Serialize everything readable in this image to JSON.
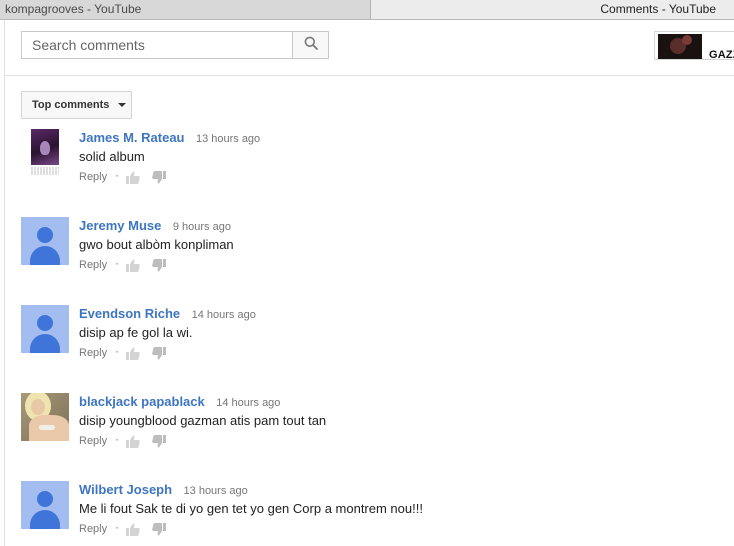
{
  "tabs": {
    "left": "kompagrooves - YouTube",
    "right": "Comments - YouTube"
  },
  "search": {
    "placeholder": "Search comments",
    "button_icon": "search-icon"
  },
  "related_video": {
    "title": "GAZZ"
  },
  "sort": {
    "label": "Top comments",
    "icon": "caret-down-icon"
  },
  "comments": [
    {
      "author": "James M. Rateau",
      "time": "13 hours ago",
      "text": "solid album",
      "avatar": "album-art",
      "reply": "Reply"
    },
    {
      "author": "Jeremy Muse",
      "time": "9 hours ago",
      "text": "gwo bout albòm konpliman",
      "avatar": "default-avatar",
      "reply": "Reply"
    },
    {
      "author": "Evendson Riche",
      "time": "14 hours ago",
      "text": "disip ap fe gol la wi.",
      "avatar": "default-avatar",
      "reply": "Reply"
    },
    {
      "author": "blackjack papablack",
      "time": "14 hours ago",
      "text": "disip youngblood gazman atis pam tout tan",
      "avatar": "photo",
      "reply": "Reply"
    },
    {
      "author": "Wilbert Joseph",
      "time": "13 hours ago",
      "text": "Me li fout Sak te di yo gen tet yo gen Corp a montrem nou!!!",
      "avatar": "default-avatar",
      "reply": "Reply"
    }
  ],
  "action_separator": "·",
  "colors": {
    "author_link": "#3e75c2",
    "default_avatar_bg": "#a4bdf0",
    "default_avatar_fg": "#3f74d8",
    "meta_text": "#767676"
  }
}
